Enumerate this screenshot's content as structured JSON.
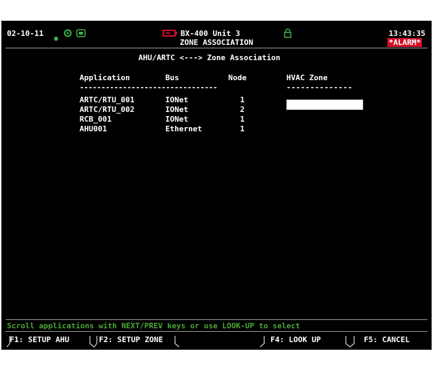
{
  "header": {
    "date": "02-10-11",
    "device": "BX-400 Unit 3",
    "screen_name": "ZONE ASSOCIATION",
    "time": "13:43:35",
    "alarm": "*ALARM*"
  },
  "title": "AHU/ARTC <---> Zone Association",
  "columns": {
    "application": "Application",
    "bus": "Bus",
    "node": "Node",
    "hvac_zone": "HVAC Zone"
  },
  "dash_rule_left": "--------------------------------",
  "dash_rule_right": "--------------",
  "rows": [
    {
      "application": "ARTC/RTU_001",
      "bus": "IONet",
      "node": "1",
      "zone": ""
    },
    {
      "application": "ARTC/RTU_002",
      "bus": "IONet",
      "node": "2",
      "zone": ""
    },
    {
      "application": "RCB_001",
      "bus": "IONet",
      "node": "1",
      "zone": ""
    },
    {
      "application": "AHU001",
      "bus": "Ethernet",
      "node": "1",
      "zone": ""
    }
  ],
  "status": "Scroll applications with NEXT/PREV keys or use LOOK-UP to select",
  "fkeys": {
    "f1": "F1: SETUP AHU",
    "f2": "F2: SETUP ZONE",
    "f4": "F4: LOOK UP",
    "f5": "F5: CANCEL"
  },
  "colors": {
    "background": "#000000",
    "text": "#ffffff",
    "status_text": "#4aa832",
    "alarm_bg": "#d0102a"
  }
}
